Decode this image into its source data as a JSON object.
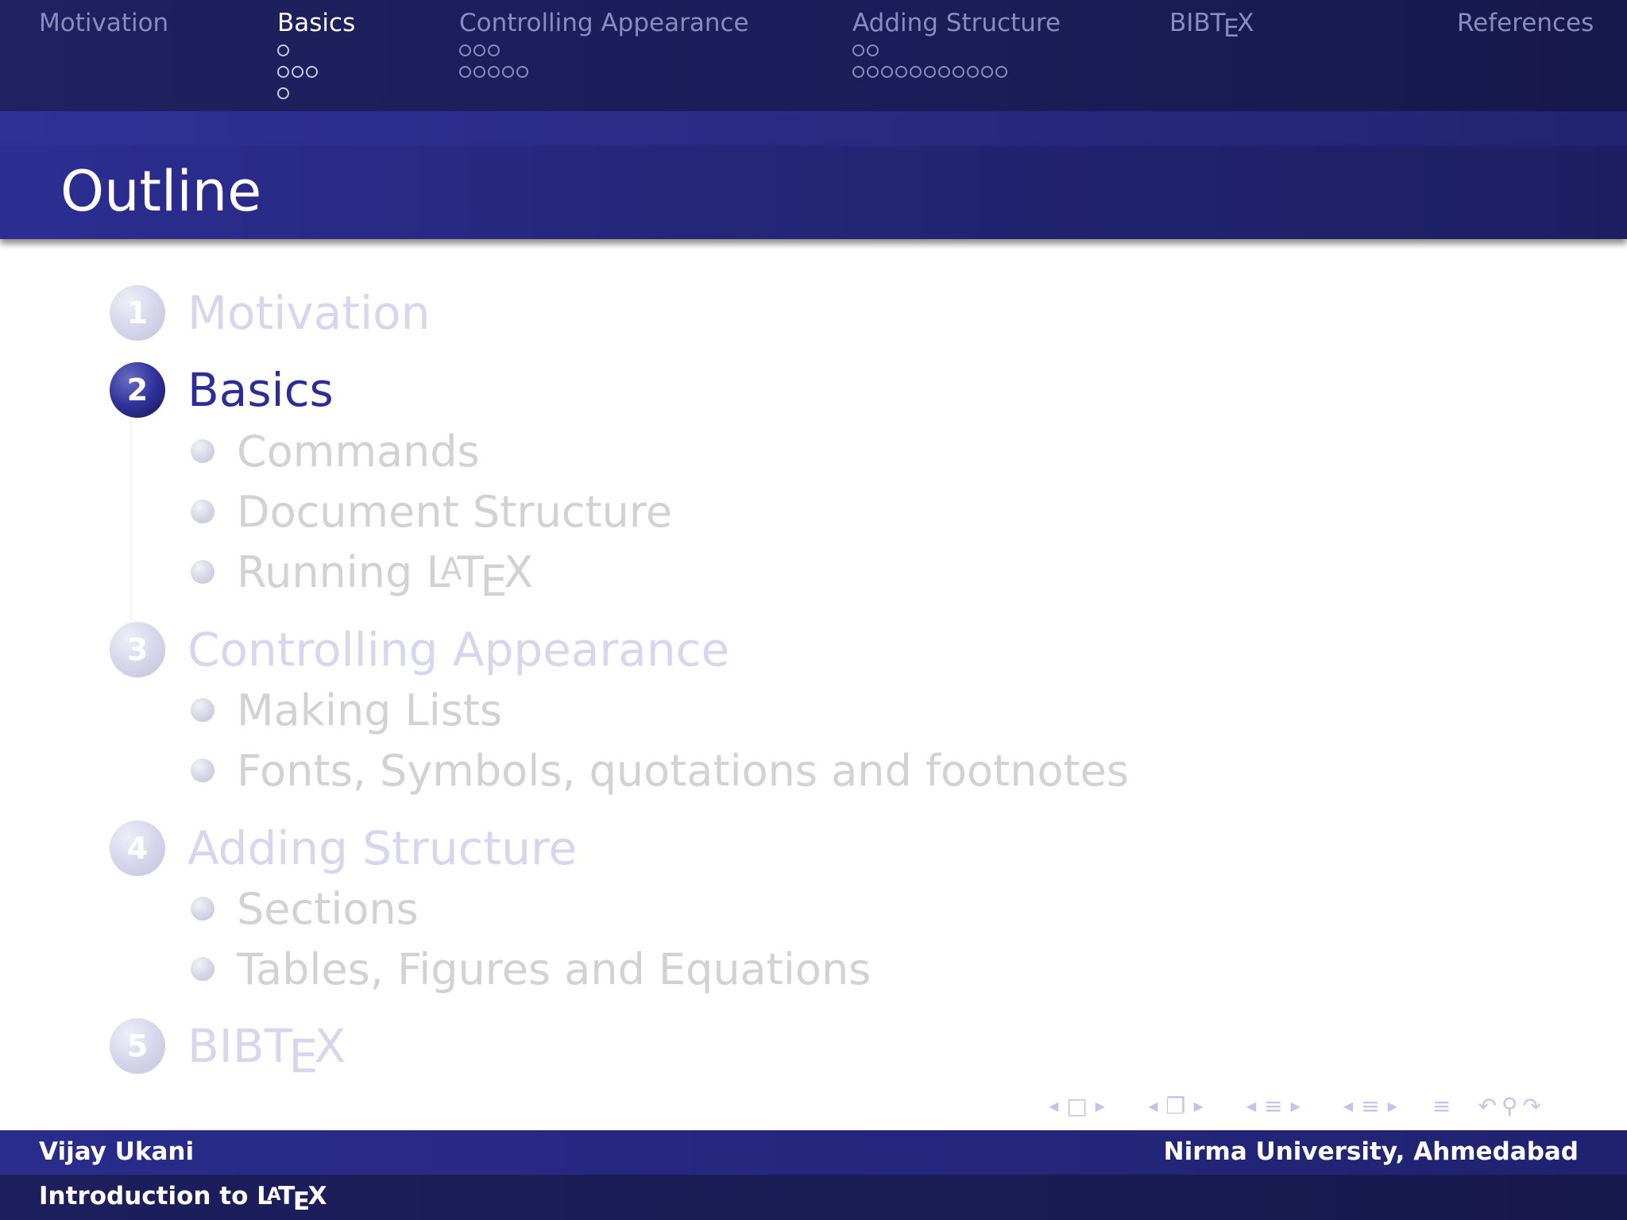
{
  "nav": {
    "sections": [
      {
        "label": "Motivation",
        "rows": [],
        "active": false
      },
      {
        "label": "Basics",
        "rows": [
          1,
          3,
          1
        ],
        "active": true
      },
      {
        "label": "Controlling Appearance",
        "rows": [
          3,
          5
        ],
        "active": false
      },
      {
        "label": "Adding Structure",
        "rows": [
          2,
          11
        ],
        "active": false
      },
      {
        "label": "BIBTEX",
        "rows": [],
        "active": false
      },
      {
        "label": "References",
        "rows": [],
        "active": false
      }
    ]
  },
  "frame_title": "Outline",
  "outline": {
    "sections": [
      {
        "number": "1",
        "label": "Motivation",
        "active": false,
        "subsections": []
      },
      {
        "number": "2",
        "label": "Basics",
        "active": true,
        "subsections": [
          "Commands",
          "Document Structure",
          "Running LATEX"
        ]
      },
      {
        "number": "3",
        "label": "Controlling Appearance",
        "active": false,
        "subsections": [
          "Making Lists",
          "Fonts, Symbols, quotations and footnotes"
        ]
      },
      {
        "number": "4",
        "label": "Adding Structure",
        "active": false,
        "subsections": [
          "Sections",
          "Tables, Figures and Equations"
        ]
      },
      {
        "number": "5",
        "label": "BIBTEX",
        "active": false,
        "subsections": []
      }
    ]
  },
  "nav_symbols": [
    "slide-nav-icon",
    "frame-nav-icon",
    "subsection-nav-icon",
    "section-nav-icon",
    "document-nav-icon",
    "back-icon",
    "search-icon",
    "forward-icon"
  ],
  "footer": {
    "author": "Vijay Ukani",
    "institute": "Nirma University, Ahmedabad",
    "title": "Introduction to LATEX"
  },
  "colors": {
    "nav_bg": "#1b1c58",
    "title_bar": "#2c2e92",
    "active_section": "#2c2e96",
    "inactive_section": "#d6d6ef",
    "inactive_subsection": "#d2d2d2"
  }
}
